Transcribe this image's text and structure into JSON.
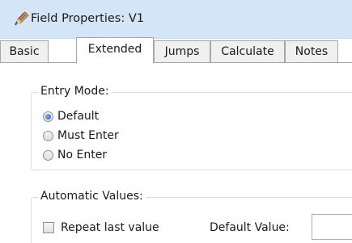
{
  "window": {
    "title": "Field Properties: V1",
    "icon": "pencil-icon"
  },
  "tabs": [
    {
      "label": "Basic"
    },
    {
      "label": "Extended"
    },
    {
      "label": "Jumps"
    },
    {
      "label": "Calculate"
    },
    {
      "label": "Notes"
    }
  ],
  "active_tab": "Extended",
  "entry_mode": {
    "legend": "Entry Mode:",
    "options": [
      {
        "label": "Default",
        "checked": true
      },
      {
        "label": "Must Enter",
        "checked": false
      },
      {
        "label": "No Enter",
        "checked": false
      }
    ]
  },
  "automatic_values": {
    "legend": "Automatic Values:",
    "repeat_last_value": {
      "label": "Repeat last value",
      "checked": false
    },
    "default_value": {
      "label": "Default Value:",
      "value": ""
    }
  }
}
